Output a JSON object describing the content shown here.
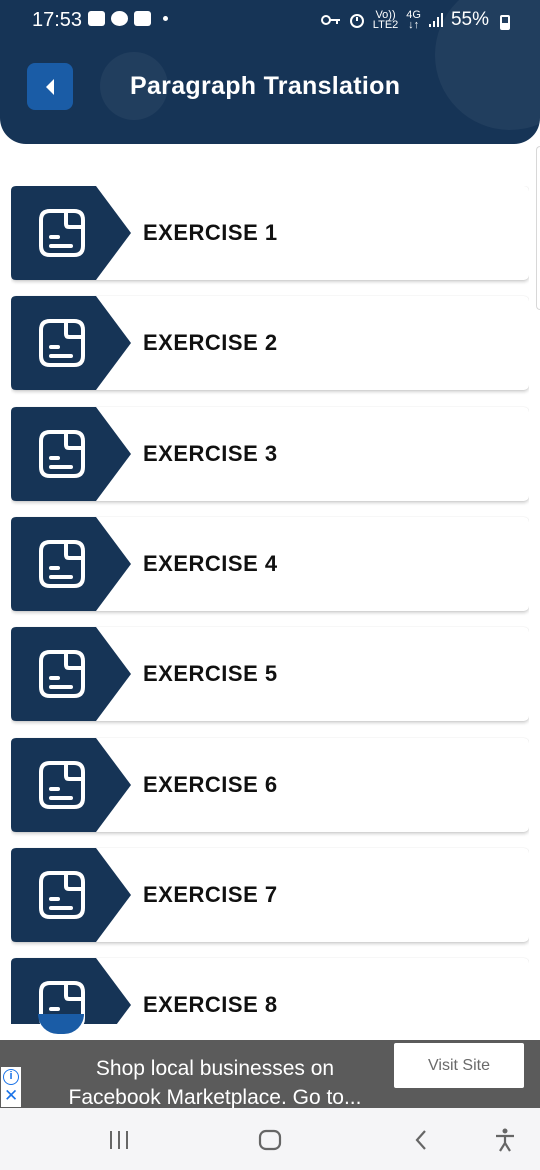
{
  "status_bar": {
    "time": "17:53",
    "network_top": "Vo))",
    "network_bottom": "LTE2",
    "gen_top": "4G",
    "gen_bottom": "↓↑",
    "battery": "55%"
  },
  "header": {
    "title": "Paragraph Translation",
    "back_icon": "chevron-left-icon",
    "bg_color": "#163456",
    "accent_color": "#1a5ca6"
  },
  "exercises": [
    {
      "label": "EXERCISE 1",
      "icon": "document-icon"
    },
    {
      "label": "EXERCISE 2",
      "icon": "document-icon"
    },
    {
      "label": "EXERCISE 3",
      "icon": "document-icon"
    },
    {
      "label": "EXERCISE 4",
      "icon": "document-icon"
    },
    {
      "label": "EXERCISE 5",
      "icon": "document-icon"
    },
    {
      "label": "EXERCISE 6",
      "icon": "document-icon"
    },
    {
      "label": "EXERCISE 7",
      "icon": "document-icon"
    },
    {
      "label": "EXERCISE 8",
      "icon": "document-icon"
    }
  ],
  "ad": {
    "text": "Shop local businesses on\nFacebook Marketplace. Go to...",
    "button_label": "Visit Site",
    "info_icon": "info-icon",
    "close_icon": "close-icon"
  },
  "navbar": {
    "items": [
      "recents-icon",
      "home-icon",
      "back-icon",
      "accessibility-icon"
    ]
  }
}
